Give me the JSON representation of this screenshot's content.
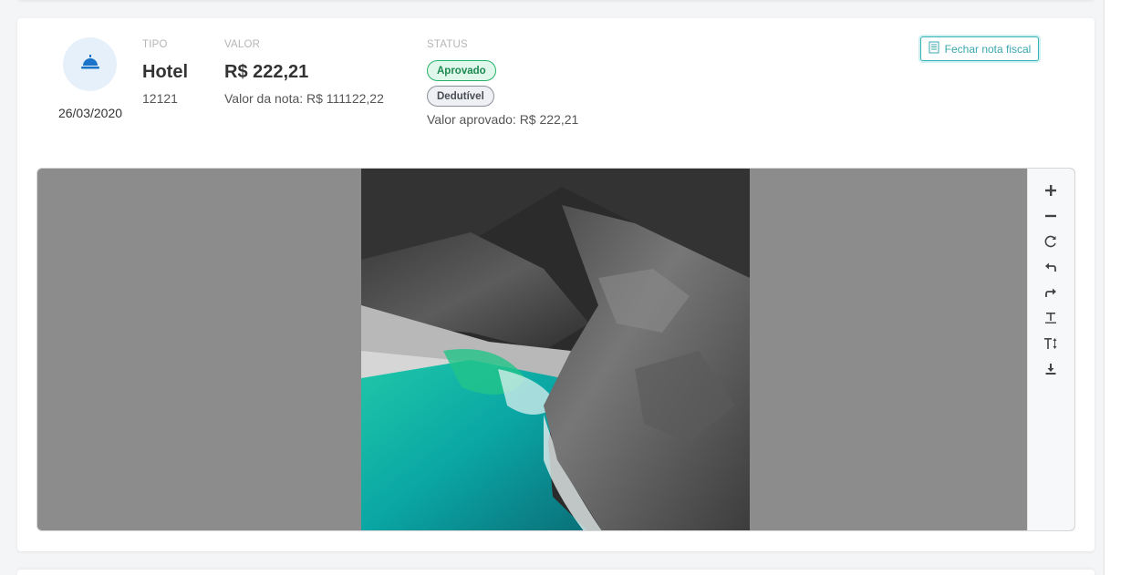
{
  "expense": {
    "date": "26/03/2020",
    "type_label": "TIPO",
    "type_value": "Hotel",
    "type_code": "12121",
    "value_label": "VALOR",
    "value_amount": "R$ 222,21",
    "invoice_value": "Valor da nota: R$ 111122,22",
    "status_label": "STATUS",
    "status_badges": [
      "Aprovado",
      "Dedutível"
    ],
    "approved_value": "Valor aprovado: R$ 222,21",
    "close_button": "Fechar nota fiscal"
  },
  "viewer_tools": [
    {
      "name": "zoom-in-icon"
    },
    {
      "name": "zoom-out-icon"
    },
    {
      "name": "reset-icon"
    },
    {
      "name": "rotate-left-icon"
    },
    {
      "name": "rotate-right-icon"
    },
    {
      "name": "fit-width-icon"
    },
    {
      "name": "fit-height-icon"
    },
    {
      "name": "download-icon"
    }
  ],
  "colors": {
    "accent": "#3ab3b8",
    "hotel_icon": "#1a73c9",
    "approved": "#27b36b",
    "viewer_bg": "#8c8c8c"
  }
}
